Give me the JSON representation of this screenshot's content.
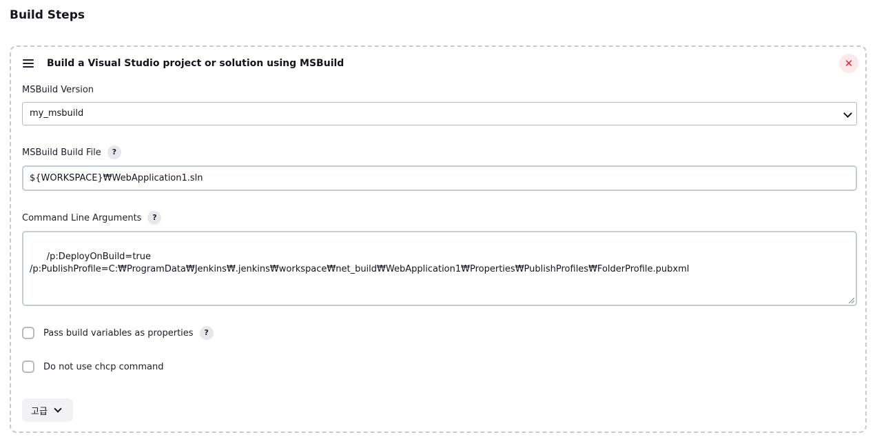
{
  "section": {
    "title": "Build Steps"
  },
  "step": {
    "title": "Build a Visual Studio project or solution using MSBuild",
    "close_symbol": "✕",
    "msbuild_version": {
      "label": "MSBuild Version",
      "selected": "my_msbuild"
    },
    "build_file": {
      "label": "MSBuild Build File",
      "value": "${WORKSPACE}₩WebApplication1.sln"
    },
    "command_line": {
      "label": "Command Line Arguments",
      "value": "/p:DeployOnBuild=true\n/p:PublishProfile=C:₩ProgramData₩Jenkins₩.jenkins₩workspace₩net_build₩WebApplication1₩Properties₩PublishProfiles₩FolderProfile.pubxml"
    },
    "pass_build_vars": {
      "label": "Pass build variables as properties",
      "checked": false
    },
    "no_chcp": {
      "label": "Do not use chcp command",
      "checked": false
    },
    "advanced_label": "고급",
    "help_symbol": "?"
  },
  "icons": {
    "drag": "drag-handle-icon",
    "close": "close-icon",
    "help": "help-icon",
    "chevron": "chevron-down-icon"
  },
  "colors": {
    "close_bg": "#fde8ec",
    "close_fg": "#e6243d",
    "border_dashed": "#c8c8cf"
  }
}
